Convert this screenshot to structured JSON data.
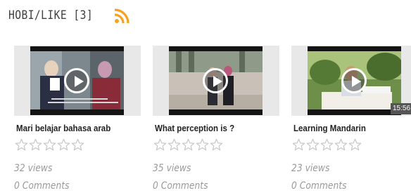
{
  "section": {
    "title": "HOBI/LIKE",
    "count": "3",
    "rss_icon": "rss-feed-icon",
    "rss_color": "#f7a21c"
  },
  "colors": {
    "star_outline": "#c8c8c8",
    "thumb_background": "#e8e8e8",
    "meta_text": "#9a9a9a"
  },
  "videos": [
    {
      "title": "Mari belajar bahasa arab",
      "rating": 0,
      "views": "32 views",
      "comments": "0 Comments",
      "play_icon": "play-icon"
    },
    {
      "title": "What perception is ?",
      "rating": 0,
      "views": "35 views",
      "comments": "0 Comments",
      "play_icon": "play-icon"
    },
    {
      "title": "Learning Mandarin",
      "rating": 0,
      "views": "23 views",
      "comments": "0 Comments",
      "duration": "15:56",
      "play_icon": "play-icon"
    }
  ]
}
